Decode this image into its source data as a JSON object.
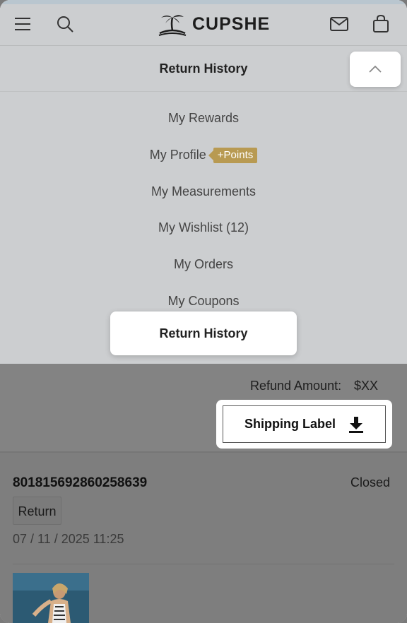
{
  "header": {
    "logo_text": "CUPSHE",
    "icons": [
      "menu-icon",
      "search-icon",
      "mail-icon",
      "bag-icon"
    ]
  },
  "panel": {
    "title": "Return History",
    "collapse_icon": "chevron-up-icon",
    "items": [
      {
        "label": "My Rewards"
      },
      {
        "label": "My Profile",
        "badge": "+Points"
      },
      {
        "label": "My Measurements"
      },
      {
        "label": "My Wishlist (12)"
      },
      {
        "label": "My Orders"
      },
      {
        "label": "My Coupons"
      }
    ],
    "active_item": "Return History"
  },
  "content": {
    "refund_label": "Refund Amount:",
    "refund_value": "$XX",
    "shipping_label_button": "Shipping Label",
    "order": {
      "number": "801815692860258639",
      "status": "Closed",
      "type": "Return",
      "date": "07 / 11 / 2025 11:25"
    }
  },
  "colors": {
    "badge_gold": "#b89a52",
    "panel_bg": "#ccced0",
    "overlay_dim": "#838383"
  }
}
